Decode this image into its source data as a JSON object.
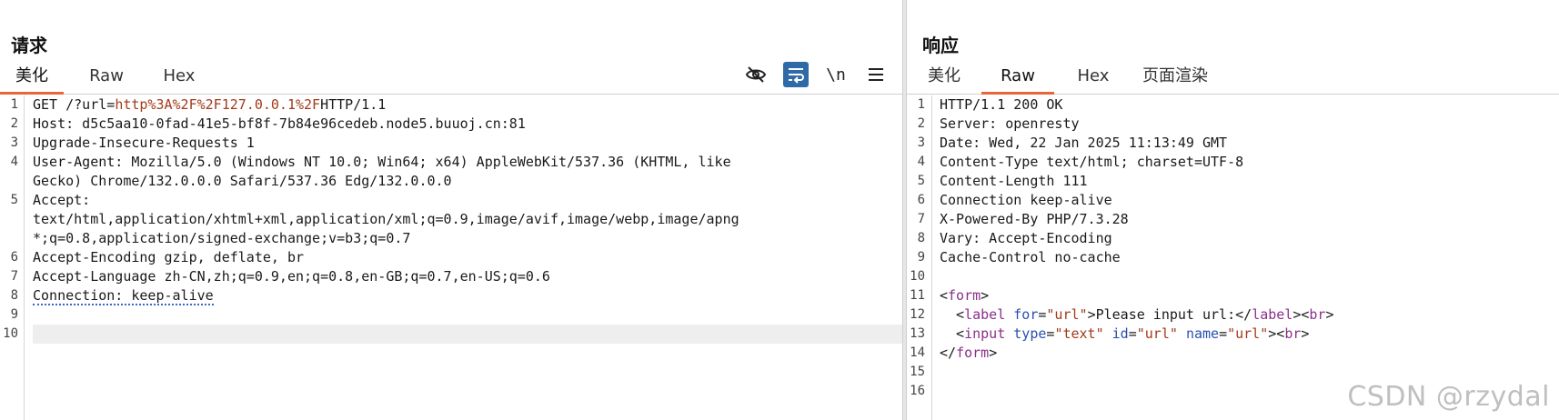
{
  "request": {
    "title": "请求",
    "tabs": [
      "美化",
      "Raw",
      "Hex"
    ],
    "active_tab": "美化",
    "toolbar": {
      "hide_icon": "eye-slash-icon",
      "wrap_icon": "word-wrap-icon",
      "newline_label": "\\n",
      "menu_icon": "hamburger-menu-icon"
    },
    "lines": [
      {
        "num": "1",
        "parts": [
          {
            "t": "GET /?url="
          },
          {
            "t": "http%3A%2F%2F127.0.0.1%2F",
            "c": "url-enc"
          },
          {
            "t": "HTTP/1.1"
          }
        ]
      },
      {
        "num": "2",
        "parts": [
          {
            "t": "Host: d5c5aa10-0fad-41e5-bf8f-7b84e96cedeb.node5.buuoj.cn:81"
          }
        ]
      },
      {
        "num": "3",
        "parts": [
          {
            "t": "Upgrade-Insecure-Requests 1"
          }
        ]
      },
      {
        "num": "4",
        "parts": [
          {
            "t": "User-Agent: Mozilla/5.0 (Windows NT 10.0; Win64; x64) AppleWebKit/537.36 (KHTML, like"
          }
        ]
      },
      {
        "num": "",
        "parts": [
          {
            "t": "Gecko) Chrome/132.0.0.0 Safari/537.36 Edg/132.0.0.0"
          }
        ]
      },
      {
        "num": "5",
        "parts": [
          {
            "t": "Accept:"
          }
        ]
      },
      {
        "num": "",
        "parts": [
          {
            "t": "text/html,application/xhtml+xml,application/xml;q=0.9,image/avif,image/webp,image/apng"
          }
        ]
      },
      {
        "num": "",
        "parts": [
          {
            "t": "*;q=0.8,application/signed-exchange;v=b3;q=0.7"
          }
        ]
      },
      {
        "num": "6",
        "parts": [
          {
            "t": "Accept-Encoding gzip, deflate, br"
          }
        ]
      },
      {
        "num": "7",
        "parts": [
          {
            "t": "Accept-Language zh-CN,zh;q=0.9,en;q=0.8,en-GB;q=0.7,en-US;q=0.6"
          }
        ]
      },
      {
        "num": "8",
        "parts": [
          {
            "t": "Connection: keep-alive",
            "c": "underline-dotted"
          }
        ]
      },
      {
        "num": "9",
        "parts": [
          {
            "t": ""
          }
        ]
      },
      {
        "num": "10",
        "parts": [
          {
            "t": ""
          }
        ],
        "highlight": true
      }
    ]
  },
  "response": {
    "title": "响应",
    "tabs": [
      "美化",
      "Raw",
      "Hex",
      "页面渲染"
    ],
    "active_tab": "Raw",
    "lines": [
      {
        "num": "1",
        "parts": [
          {
            "t": "HTTP/1.1 200 OK"
          }
        ]
      },
      {
        "num": "2",
        "parts": [
          {
            "t": "Server: openresty"
          }
        ]
      },
      {
        "num": "3",
        "parts": [
          {
            "t": "Date: Wed, 22 Jan 2025 11:13:49 GMT"
          }
        ]
      },
      {
        "num": "4",
        "parts": [
          {
            "t": "Content-Type text/html; charset=UTF-8"
          }
        ]
      },
      {
        "num": "5",
        "parts": [
          {
            "t": "Content-Length 111"
          }
        ]
      },
      {
        "num": "6",
        "parts": [
          {
            "t": "Connection keep-alive"
          }
        ]
      },
      {
        "num": "7",
        "parts": [
          {
            "t": "X-Powered-By PHP/7.3.28"
          }
        ]
      },
      {
        "num": "8",
        "parts": [
          {
            "t": "Vary: Accept-Encoding"
          }
        ]
      },
      {
        "num": "9",
        "parts": [
          {
            "t": "Cache-Control no-cache"
          }
        ]
      },
      {
        "num": "10",
        "parts": [
          {
            "t": ""
          }
        ]
      },
      {
        "num": "11",
        "parts": [
          {
            "t": "<"
          },
          {
            "t": "form",
            "c": "tag"
          },
          {
            "t": ">"
          }
        ]
      },
      {
        "num": "12",
        "parts": [
          {
            "t": "  <"
          },
          {
            "t": "label",
            "c": "tag"
          },
          {
            "t": " "
          },
          {
            "t": "for",
            "c": "attr"
          },
          {
            "t": "="
          },
          {
            "t": "\"url\"",
            "c": "str"
          },
          {
            "t": ">Please input url:</"
          },
          {
            "t": "label",
            "c": "tag"
          },
          {
            "t": "><"
          },
          {
            "t": "br",
            "c": "tag"
          },
          {
            "t": ">"
          }
        ]
      },
      {
        "num": "13",
        "parts": [
          {
            "t": "  <"
          },
          {
            "t": "input",
            "c": "tag"
          },
          {
            "t": " "
          },
          {
            "t": "type",
            "c": "attr"
          },
          {
            "t": "="
          },
          {
            "t": "\"text\"",
            "c": "str"
          },
          {
            "t": " "
          },
          {
            "t": "id",
            "c": "attr"
          },
          {
            "t": "="
          },
          {
            "t": "\"url\"",
            "c": "str"
          },
          {
            "t": " "
          },
          {
            "t": "name",
            "c": "attr"
          },
          {
            "t": "="
          },
          {
            "t": "\"url\"",
            "c": "str"
          },
          {
            "t": "><"
          },
          {
            "t": "br",
            "c": "tag"
          },
          {
            "t": ">"
          }
        ]
      },
      {
        "num": "14",
        "parts": [
          {
            "t": "</"
          },
          {
            "t": "form",
            "c": "tag"
          },
          {
            "t": ">"
          }
        ]
      },
      {
        "num": "15",
        "parts": [
          {
            "t": ""
          }
        ]
      },
      {
        "num": "16",
        "parts": [
          {
            "t": ""
          }
        ]
      }
    ]
  },
  "watermark": "CSDN @rzydal",
  "colors": {
    "active_tab_underline": "#e8663a",
    "wrap_button_bg": "#2e6aa8",
    "url_encoded": "#a33a1a",
    "html_tag": "#8a2f8a",
    "html_attr": "#2a4fb0"
  }
}
